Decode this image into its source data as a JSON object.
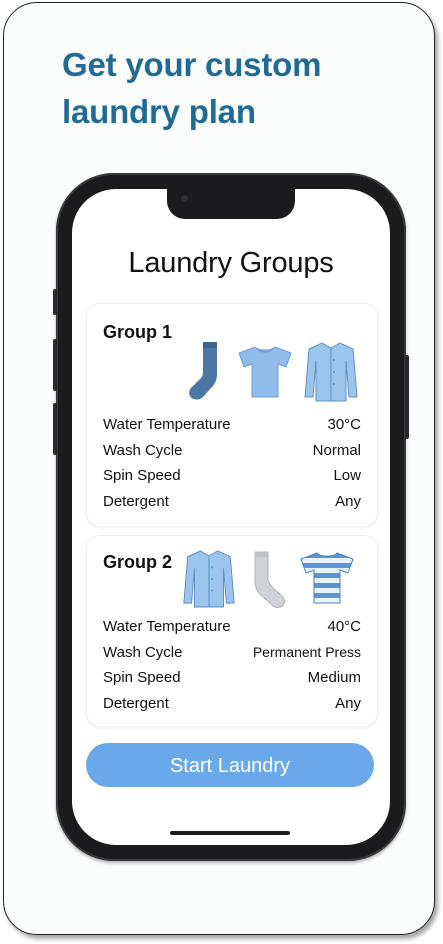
{
  "headline": "Get your custom laundry plan",
  "screen": {
    "title": "Laundry Groups",
    "start_button": "Start Laundry"
  },
  "groups": [
    {
      "title": "Group 1",
      "icons": [
        "sock-icon",
        "tshirt-icon",
        "button-shirt-icon"
      ],
      "rows": [
        {
          "label": "Water Temperature",
          "value": "30°C"
        },
        {
          "label": "Wash Cycle",
          "value": "Normal"
        },
        {
          "label": "Spin Speed",
          "value": "Low"
        },
        {
          "label": "Detergent",
          "value": "Any"
        }
      ]
    },
    {
      "title": "Group 2",
      "icons": [
        "button-shirt-icon",
        "sock-icon",
        "striped-tshirt-icon"
      ],
      "rows": [
        {
          "label": "Water Temperature",
          "value": "40°C"
        },
        {
          "label": "Wash Cycle",
          "value": "Permanent Press"
        },
        {
          "label": "Spin Speed",
          "value": "Medium"
        },
        {
          "label": "Detergent",
          "value": "Any"
        }
      ]
    }
  ],
  "colors": {
    "headline": "#1f6b96",
    "button": "#6aa9e9",
    "phone_frame": "#1b1b1d"
  }
}
